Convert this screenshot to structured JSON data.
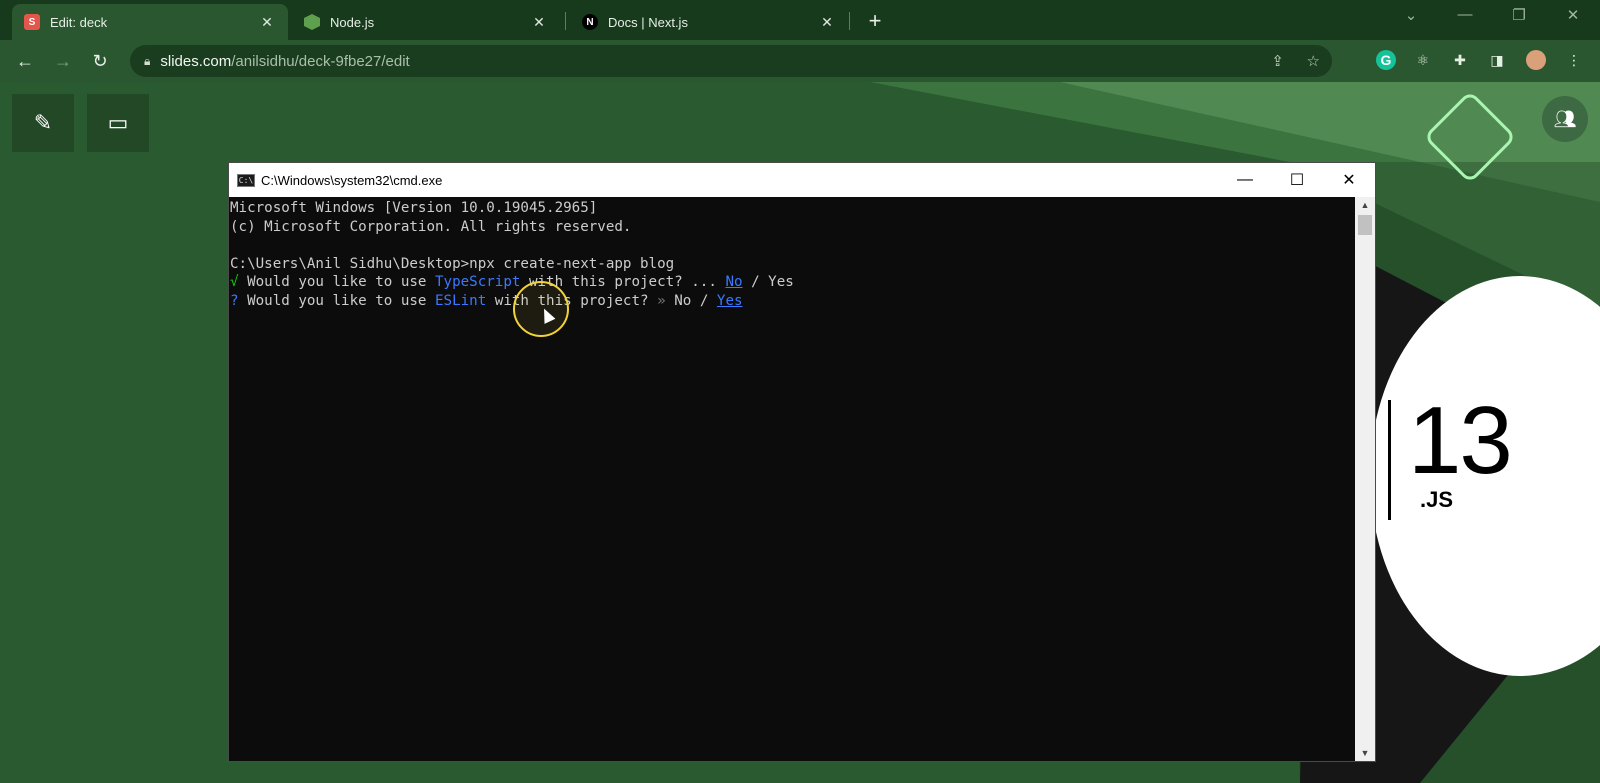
{
  "browser": {
    "tabs": [
      {
        "title": "Edit: deck",
        "favicon": "S",
        "active": true
      },
      {
        "title": "Node.js",
        "favicon": "node-hex",
        "active": false
      },
      {
        "title": "Docs | Next.js",
        "favicon": "N",
        "active": false
      }
    ],
    "address": {
      "host": "slides.com",
      "path": "/anilsidhu/deck-9fbe27/edit"
    }
  },
  "cmd": {
    "title": "C:\\Windows\\system32\\cmd.exe",
    "lines": {
      "l1": "Microsoft Windows [Version 10.0.19045.2965]",
      "l2": "(c) Microsoft Corporation. All rights reserved.",
      "l3": "C:\\Users\\Anil Sidhu\\Desktop>npx create-next-app blog",
      "q1_mark": "√",
      "q1_pre": " Would you like to use ",
      "q1_tool": "TypeScript",
      "q1_post": " with this project? ... ",
      "q1_no": "No",
      "q1_sep": " / ",
      "q1_yes": "Yes",
      "q2_mark": "?",
      "q2_pre": " Would you like to use ",
      "q2_tool": "ESLint",
      "q2_post": " with this project? ",
      "q2_arrow": "»",
      "q2_no": " No",
      "q2_sep": " / ",
      "q2_yes": "Yes"
    }
  },
  "slide_art": {
    "version": "13",
    "suffix": ".JS"
  },
  "colors": {
    "tabstrip": "#173a1c",
    "toolbar": "#2a5730",
    "slide_bg": "#2a5a2f",
    "terminal_bg": "#0c0c0c",
    "terminal_blue": "#3b78ff",
    "terminal_green": "#16c60c"
  }
}
